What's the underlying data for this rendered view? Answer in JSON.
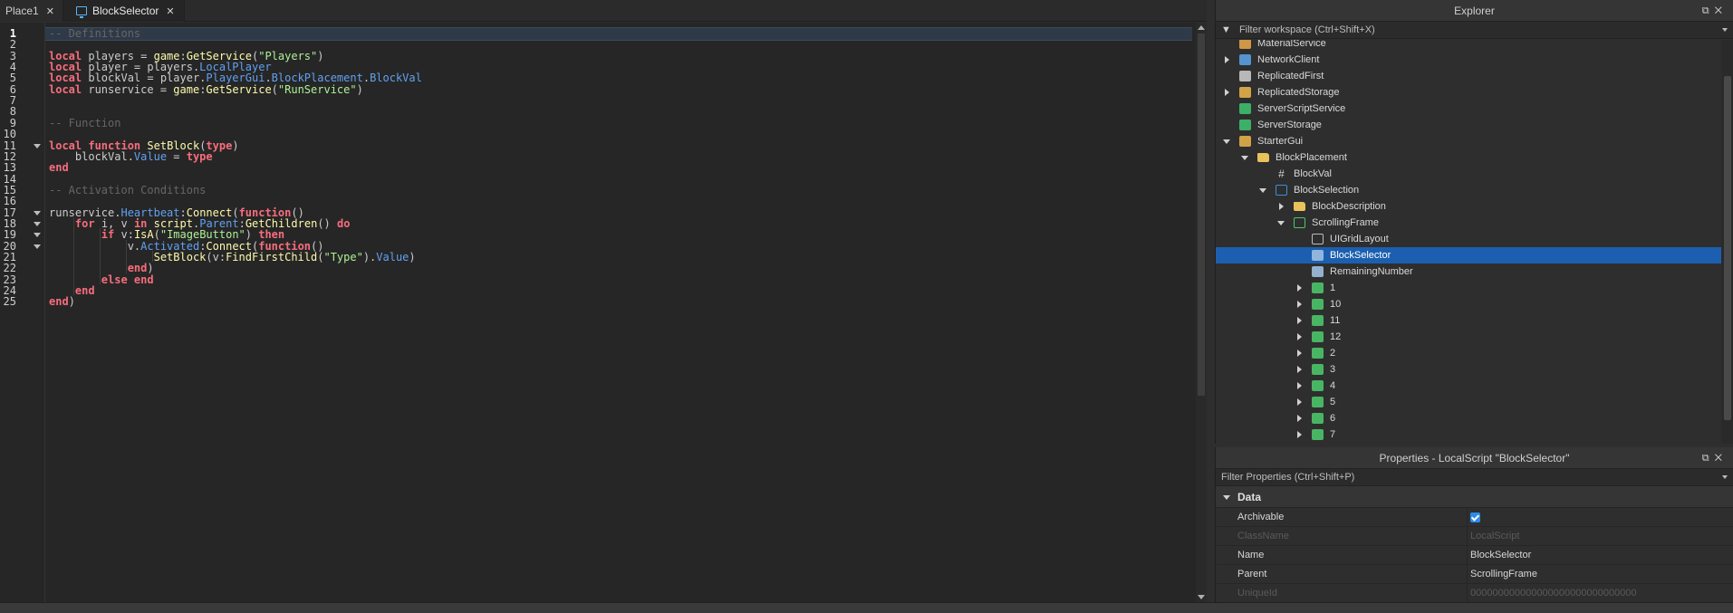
{
  "tabs": [
    {
      "label": "Place1"
    },
    {
      "label": "BlockSelector"
    }
  ],
  "editor": {
    "line_numbers": [
      "1",
      "2",
      "3",
      "4",
      "5",
      "6",
      "7",
      "8",
      "9",
      "10",
      "11",
      "12",
      "13",
      "14",
      "15",
      "16",
      "17",
      "18",
      "19",
      "20",
      "21",
      "22",
      "23",
      "24",
      "25"
    ],
    "lines": [
      [
        {
          "t": "-- Definitions",
          "c": "com"
        }
      ],
      [],
      [
        {
          "t": "local",
          "c": "kw"
        },
        {
          "t": " players = ",
          "c": "id"
        },
        {
          "t": "game",
          "c": "fn"
        },
        {
          "t": ":",
          "c": "id"
        },
        {
          "t": "GetService",
          "c": "fn"
        },
        {
          "t": "(",
          "c": "id"
        },
        {
          "t": "\"Players\"",
          "c": "str"
        },
        {
          "t": ")",
          "c": "id"
        }
      ],
      [
        {
          "t": "local",
          "c": "kw"
        },
        {
          "t": " player = players.",
          "c": "id"
        },
        {
          "t": "LocalPlayer",
          "c": "prop"
        }
      ],
      [
        {
          "t": "local",
          "c": "kw"
        },
        {
          "t": " blockVal = player.",
          "c": "id"
        },
        {
          "t": "PlayerGui",
          "c": "prop"
        },
        {
          "t": ".",
          "c": "id"
        },
        {
          "t": "BlockPlacement",
          "c": "prop"
        },
        {
          "t": ".",
          "c": "id"
        },
        {
          "t": "BlockVal",
          "c": "prop"
        }
      ],
      [
        {
          "t": "local",
          "c": "kw"
        },
        {
          "t": " runservice = ",
          "c": "id"
        },
        {
          "t": "game",
          "c": "fn"
        },
        {
          "t": ":",
          "c": "id"
        },
        {
          "t": "GetService",
          "c": "fn"
        },
        {
          "t": "(",
          "c": "id"
        },
        {
          "t": "\"RunService\"",
          "c": "str"
        },
        {
          "t": ")",
          "c": "id"
        }
      ],
      [],
      [],
      [
        {
          "t": "-- Function",
          "c": "com"
        }
      ],
      [],
      [
        {
          "t": "local function",
          "c": "kw"
        },
        {
          "t": " ",
          "c": "id"
        },
        {
          "t": "SetBlock",
          "c": "fn"
        },
        {
          "t": "(",
          "c": "id"
        },
        {
          "t": "type",
          "c": "kw"
        },
        {
          "t": ")",
          "c": "id"
        }
      ],
      [
        {
          "t": "    blockVal.",
          "c": "id"
        },
        {
          "t": "Value",
          "c": "prop"
        },
        {
          "t": " = ",
          "c": "id"
        },
        {
          "t": "type",
          "c": "kw"
        }
      ],
      [
        {
          "t": "end",
          "c": "kw"
        }
      ],
      [],
      [
        {
          "t": "-- Activation Conditions",
          "c": "com"
        }
      ],
      [],
      [
        {
          "t": "runservice.",
          "c": "id"
        },
        {
          "t": "Heartbeat",
          "c": "prop"
        },
        {
          "t": ":",
          "c": "id"
        },
        {
          "t": "Connect",
          "c": "fn"
        },
        {
          "t": "(",
          "c": "id"
        },
        {
          "t": "function",
          "c": "kw"
        },
        {
          "t": "()",
          "c": "id"
        }
      ],
      [
        {
          "t": "    ",
          "c": "id"
        },
        {
          "t": "for",
          "c": "kw"
        },
        {
          "t": " i, v ",
          "c": "id"
        },
        {
          "t": "in",
          "c": "kw"
        },
        {
          "t": " ",
          "c": "id"
        },
        {
          "t": "script",
          "c": "fn"
        },
        {
          "t": ".",
          "c": "id"
        },
        {
          "t": "Parent",
          "c": "prop"
        },
        {
          "t": ":",
          "c": "id"
        },
        {
          "t": "GetChildren",
          "c": "fn"
        },
        {
          "t": "() ",
          "c": "id"
        },
        {
          "t": "do",
          "c": "kw"
        }
      ],
      [
        {
          "t": "        ",
          "c": "id"
        },
        {
          "t": "if",
          "c": "kw"
        },
        {
          "t": " v:",
          "c": "id"
        },
        {
          "t": "IsA",
          "c": "fn"
        },
        {
          "t": "(",
          "c": "id"
        },
        {
          "t": "\"ImageButton\"",
          "c": "str"
        },
        {
          "t": ") ",
          "c": "id"
        },
        {
          "t": "then",
          "c": "kw"
        }
      ],
      [
        {
          "t": "            v.",
          "c": "id"
        },
        {
          "t": "Activated",
          "c": "prop"
        },
        {
          "t": ":",
          "c": "id"
        },
        {
          "t": "Connect",
          "c": "fn"
        },
        {
          "t": "(",
          "c": "id"
        },
        {
          "t": "function",
          "c": "kw"
        },
        {
          "t": "()",
          "c": "id"
        }
      ],
      [
        {
          "t": "                ",
          "c": "id"
        },
        {
          "t": "SetBlock",
          "c": "fn"
        },
        {
          "t": "(v:",
          "c": "id"
        },
        {
          "t": "FindFirstChild",
          "c": "fn"
        },
        {
          "t": "(",
          "c": "id"
        },
        {
          "t": "\"Type\"",
          "c": "str"
        },
        {
          "t": ").",
          "c": "id"
        },
        {
          "t": "Value",
          "c": "prop"
        },
        {
          "t": ")",
          "c": "id"
        }
      ],
      [
        {
          "t": "            ",
          "c": "id"
        },
        {
          "t": "end",
          "c": "kw"
        },
        {
          "t": ")",
          "c": "id"
        }
      ],
      [
        {
          "t": "        ",
          "c": "id"
        },
        {
          "t": "else end",
          "c": "kw"
        }
      ],
      [
        {
          "t": "    ",
          "c": "id"
        },
        {
          "t": "end",
          "c": "kw"
        }
      ],
      [
        {
          "t": "end",
          "c": "kw"
        },
        {
          "t": ")",
          "c": "id"
        }
      ]
    ]
  },
  "explorer": {
    "title": "Explorer",
    "filter_placeholder": "Filter workspace (Ctrl+Shift+X)",
    "items": [
      {
        "label": "MaterialService",
        "depth": 0,
        "exp": "none",
        "icon": "material-service-icon",
        "color": "#e2a34a"
      },
      {
        "label": "NetworkClient",
        "depth": 0,
        "exp": "collapsed",
        "icon": "network-client-icon",
        "color": "#5aa0e0"
      },
      {
        "label": "ReplicatedFirst",
        "depth": 0,
        "exp": "none",
        "icon": "replicated-first-icon",
        "color": "#c8c8c8"
      },
      {
        "label": "ReplicatedStorage",
        "depth": 0,
        "exp": "collapsed",
        "icon": "replicated-storage-icon",
        "color": "#e2b04a"
      },
      {
        "label": "ServerScriptService",
        "depth": 0,
        "exp": "none",
        "icon": "server-script-service-icon",
        "color": "#3fbf6f"
      },
      {
        "label": "ServerStorage",
        "depth": 0,
        "exp": "none",
        "icon": "server-storage-icon",
        "color": "#3fbf6f"
      },
      {
        "label": "StarterGui",
        "depth": 0,
        "exp": "expanded",
        "icon": "starter-gui-icon",
        "color": "#e2b04a"
      },
      {
        "label": "BlockPlacement",
        "depth": 1,
        "exp": "expanded",
        "icon": "folder-icon",
        "color": "#e8c25a"
      },
      {
        "label": "BlockVal",
        "depth": 2,
        "exp": "none",
        "icon": "hash-icon",
        "color": "none"
      },
      {
        "label": "BlockSelection",
        "depth": 2,
        "exp": "expanded",
        "icon": "frame-icon",
        "color": "#3f8fd6"
      },
      {
        "label": "BlockDescription",
        "depth": 3,
        "exp": "collapsed",
        "icon": "folder-icon",
        "color": "#e8c25a"
      },
      {
        "label": "ScrollingFrame",
        "depth": 3,
        "exp": "expanded",
        "icon": "scrolling-frame-icon",
        "color": "#4cc46a"
      },
      {
        "label": "UIGridLayout",
        "depth": 4,
        "exp": "none",
        "icon": "grid-layout-icon",
        "color": "#bdbdbd"
      },
      {
        "label": "BlockSelector",
        "depth": 4,
        "exp": "none",
        "icon": "local-script-icon",
        "color": "#9fbfe0",
        "selected": true
      },
      {
        "label": "RemainingNumber",
        "depth": 4,
        "exp": "none",
        "icon": "local-script-icon",
        "color": "#9fbfe0"
      },
      {
        "label": "1",
        "depth": 4,
        "exp": "collapsed",
        "icon": "image-button-icon",
        "color": "#4cc46a"
      },
      {
        "label": "10",
        "depth": 4,
        "exp": "collapsed",
        "icon": "image-button-icon",
        "color": "#4cc46a"
      },
      {
        "label": "11",
        "depth": 4,
        "exp": "collapsed",
        "icon": "image-button-icon",
        "color": "#4cc46a"
      },
      {
        "label": "12",
        "depth": 4,
        "exp": "collapsed",
        "icon": "image-button-icon",
        "color": "#4cc46a"
      },
      {
        "label": "2",
        "depth": 4,
        "exp": "collapsed",
        "icon": "image-button-icon",
        "color": "#4cc46a"
      },
      {
        "label": "3",
        "depth": 4,
        "exp": "collapsed",
        "icon": "image-button-icon",
        "color": "#4cc46a"
      },
      {
        "label": "4",
        "depth": 4,
        "exp": "collapsed",
        "icon": "image-button-icon",
        "color": "#4cc46a"
      },
      {
        "label": "5",
        "depth": 4,
        "exp": "collapsed",
        "icon": "image-button-icon",
        "color": "#4cc46a"
      },
      {
        "label": "6",
        "depth": 4,
        "exp": "collapsed",
        "icon": "image-button-icon",
        "color": "#4cc46a"
      },
      {
        "label": "7",
        "depth": 4,
        "exp": "collapsed",
        "icon": "image-button-icon",
        "color": "#4cc46a"
      }
    ]
  },
  "properties": {
    "title": "Properties - LocalScript \"BlockSelector\"",
    "filter_placeholder": "Filter Properties (Ctrl+Shift+P)",
    "section": "Data",
    "rows": [
      {
        "name": "Archivable",
        "value": "",
        "checkbox": true,
        "dim": false
      },
      {
        "name": "ClassName",
        "value": "LocalScript",
        "checkbox": false,
        "dim": true
      },
      {
        "name": "Name",
        "value": "BlockSelector",
        "checkbox": false,
        "dim": false
      },
      {
        "name": "Parent",
        "value": "ScrollingFrame",
        "checkbox": false,
        "dim": false
      },
      {
        "name": "UniqueId",
        "value": "000000000000000000000000000000",
        "checkbox": false,
        "dim": true
      }
    ]
  },
  "colors": {
    "selection": "#1c5fb0",
    "keyword": "#f86d7c",
    "string": "#adf195",
    "function": "#fdfbac",
    "property": "#61a1f1",
    "comment": "#666666"
  }
}
